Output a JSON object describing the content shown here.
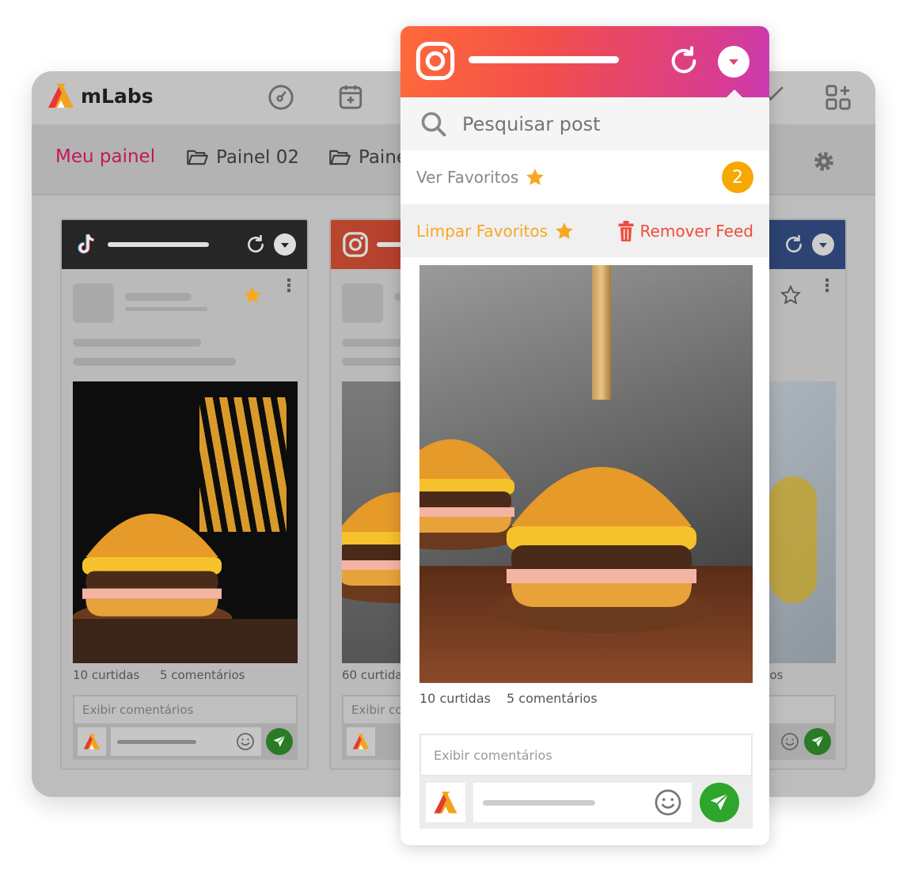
{
  "app": {
    "name": "mLabs"
  },
  "topbar": {
    "icons": [
      "dashboard-icon",
      "calendar-add-icon",
      "analytics-icon",
      "add-widget-icon"
    ]
  },
  "tabs": [
    {
      "label": "Meu painel",
      "active": true
    },
    {
      "label": "Painel 02"
    },
    {
      "label": "Painel"
    }
  ],
  "colors": {
    "active_tab": "#c2185b",
    "tiktok_header": "#262626",
    "facebook_header": "#2d4373",
    "favorite": "#f7a823",
    "remove": "#ef4b3c",
    "badge": "#f7a800",
    "send": "#2ea52b"
  },
  "feeds": [
    {
      "network": "tiktok",
      "likes": "10 curtidas",
      "comments": "5 comentários",
      "show_comments": "Exibir comentários",
      "favorited": true
    },
    {
      "network": "instagram",
      "likes": "60 curtidas",
      "show_comments": "Exibir comentários"
    },
    {
      "network": "facebook",
      "comments": "5 comentários",
      "favorited": false
    }
  ],
  "popup": {
    "network": "instagram",
    "search_placeholder": "Pesquisar post",
    "view_favorites": "Ver Favoritos",
    "favorites_count": "2",
    "clear_favorites": "Limpar Favoritos",
    "remove_feed": "Remover Feed",
    "likes": "10 curtidas",
    "comments": "5 comentários",
    "show_comments": "Exibir comentários"
  }
}
